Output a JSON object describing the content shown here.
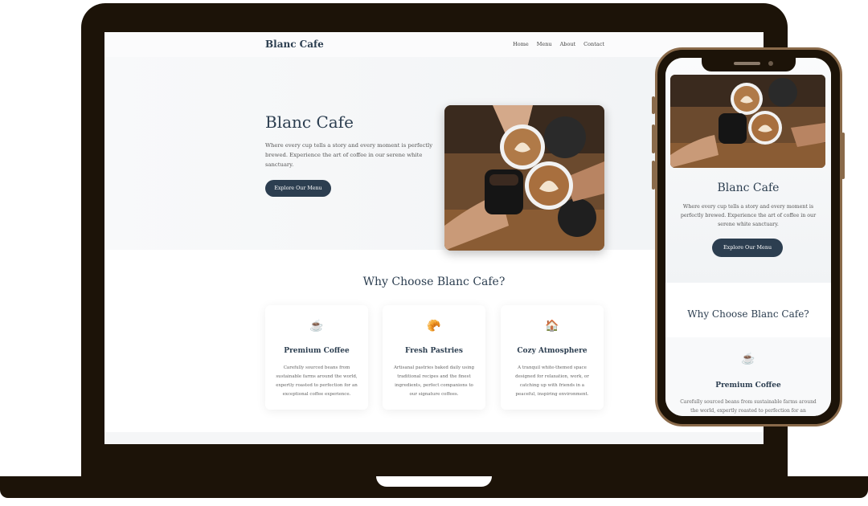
{
  "brand": {
    "name": "Blanc Cafe"
  },
  "nav": {
    "links": [
      "Home",
      "Menu",
      "About",
      "Contact"
    ]
  },
  "hero": {
    "title": "Blanc Cafe",
    "text": "Where every cup tells a story and every moment is perfectly brewed. Experience the art of coffee in our serene white sanctuary.",
    "button": "Explore Our Menu"
  },
  "why": {
    "title": "Why Choose Blanc Cafe?",
    "cards": [
      {
        "icon": "coffee-cup-icon",
        "glyph": "☕",
        "title": "Premium Coffee",
        "text": "Carefully sourced beans from sustainable farms around the world, expertly roasted to perfection for an exceptional coffee experience."
      },
      {
        "icon": "croissant-icon",
        "glyph": "🥐",
        "title": "Fresh Pastries",
        "text": "Artisanal pastries baked daily using traditional recipes and the finest ingredients, perfect companions to our signature coffees."
      },
      {
        "icon": "house-icon",
        "glyph": "🏠",
        "title": "Cozy Atmosphere",
        "text": "A tranquil white-themed space designed for relaxation, work, or catching up with friends in a peaceful, inspiring environment."
      }
    ]
  },
  "mobile": {
    "card_text": "Carefully sourced beans from sustainable farms around the world, expertly roasted to perfection for an exceptional"
  },
  "colors": {
    "primary": "#2c3e50",
    "device": "#1c1308",
    "phone_rim": "#8a6a4a"
  }
}
